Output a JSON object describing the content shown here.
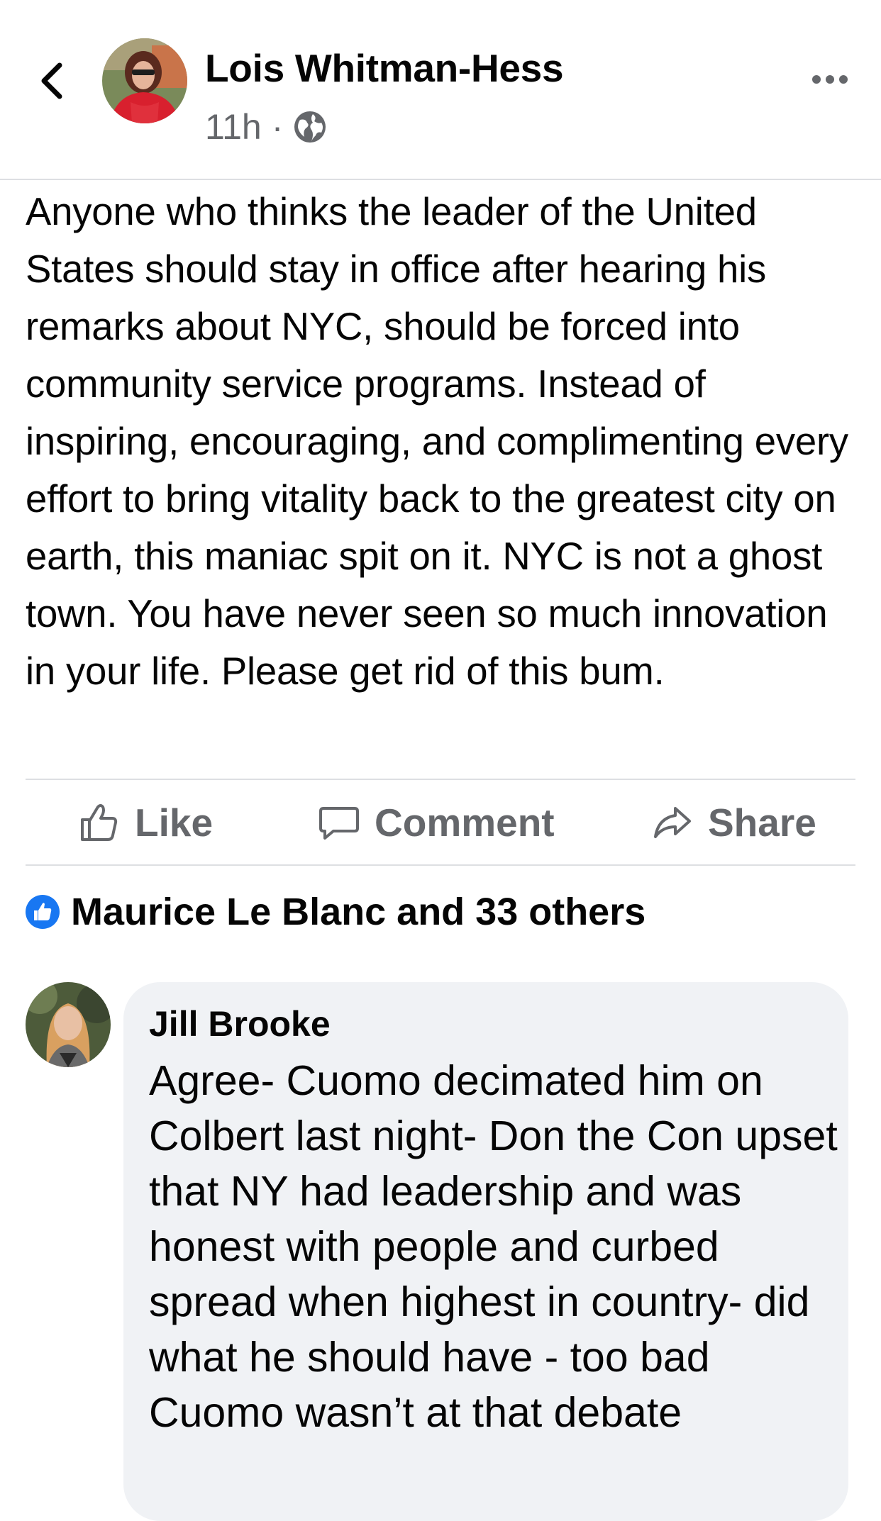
{
  "post": {
    "author": "Lois Whitman-Hess",
    "time": "11h",
    "separator": "·",
    "privacy_icon": "globe-icon",
    "text": "Anyone who thinks the leader of the United States should stay in office after hearing his remarks about NYC, should be forced into community service programs. Instead of inspiring, encouraging, and complimenting every effort to bring vitality back to the greatest city on earth, this maniac spit on it. NYC is not a ghost town. You have never seen so much innovation in your life. Please get rid of this bum."
  },
  "actions": {
    "like": "Like",
    "comment": "Comment",
    "share": "Share"
  },
  "reactions": {
    "summary": "Maurice Le Blanc and 33 others",
    "icon": "thumbs-up-icon"
  },
  "comment": {
    "author": "Jill Brooke",
    "text": "Agree- Cuomo decimated him on Colbert last night- Don the Con upset that NY had leadership and was honest with people and curbed spread when highest in country- did what he should have - too bad Cuomo wasn’t at that debate"
  },
  "colors": {
    "brand_blue": "#1877f2",
    "secondary_text": "#65676b",
    "comment_bg": "#f0f2f5",
    "divider": "#dddfe2"
  }
}
